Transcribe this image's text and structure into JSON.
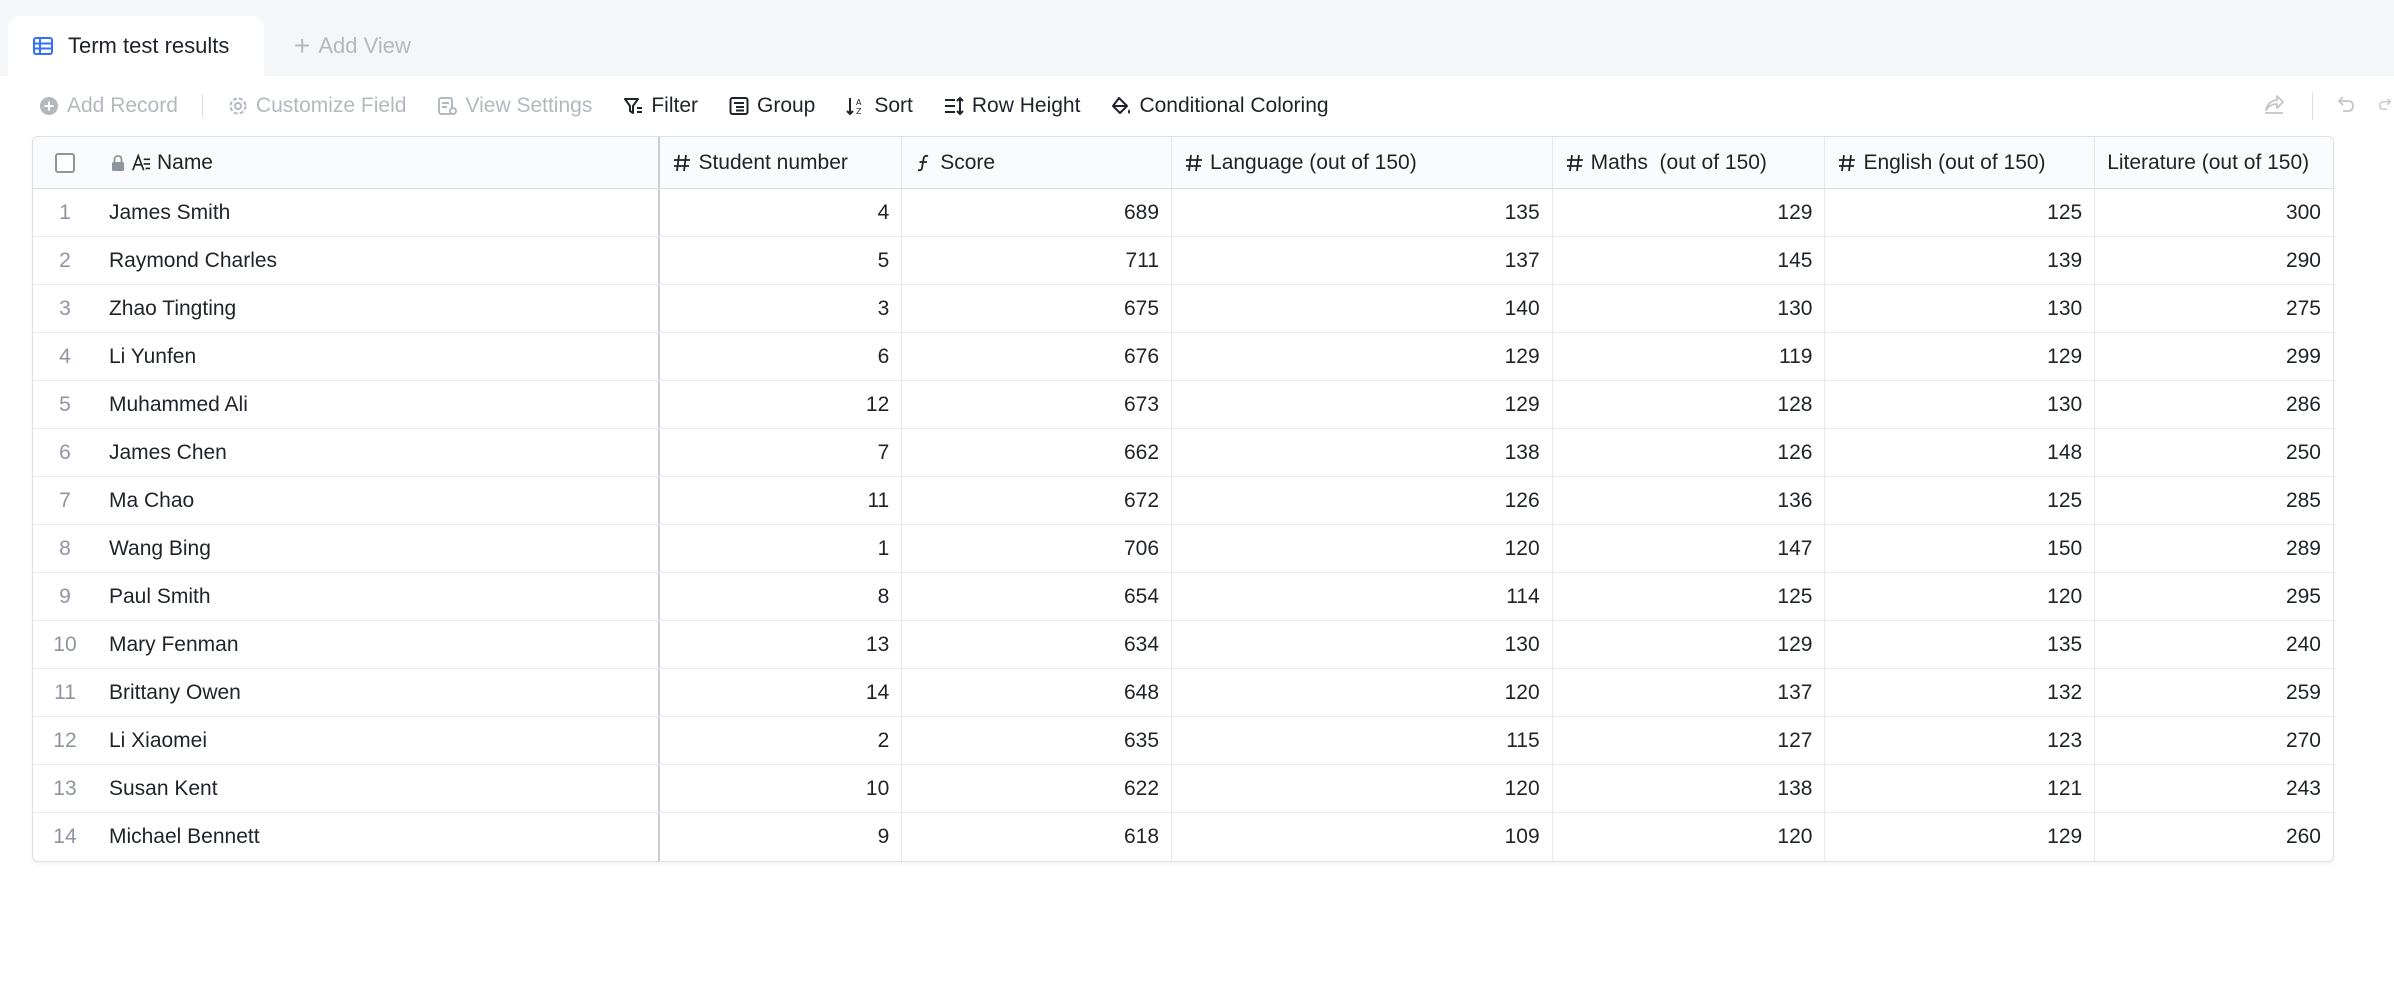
{
  "tabs": {
    "active_label": "Term test results",
    "add_view_label": "Add View"
  },
  "toolbar": {
    "add_record": "Add Record",
    "customize_field": "Customize Field",
    "view_settings": "View Settings",
    "filter": "Filter",
    "group": "Group",
    "sort": "Sort",
    "row_height": "Row Height",
    "conditional_coloring": "Conditional Coloring"
  },
  "columns": {
    "name": "Name",
    "student_number": "Student number",
    "score": "Score",
    "language": "Language (out of 150)",
    "maths": "Maths  (out of 150)",
    "english": "English (out of 150)",
    "literature": "Literature (out of 150)"
  },
  "rows": [
    {
      "num": "1",
      "name": "James Smith",
      "sn": "4",
      "score": "689",
      "lang": "135",
      "math": "129",
      "eng": "125",
      "lit": "300"
    },
    {
      "num": "2",
      "name": "Raymond Charles",
      "sn": "5",
      "score": "711",
      "lang": "137",
      "math": "145",
      "eng": "139",
      "lit": "290"
    },
    {
      "num": "3",
      "name": "Zhao Tingting",
      "sn": "3",
      "score": "675",
      "lang": "140",
      "math": "130",
      "eng": "130",
      "lit": "275"
    },
    {
      "num": "4",
      "name": "Li Yunfen",
      "sn": "6",
      "score": "676",
      "lang": "129",
      "math": "119",
      "eng": "129",
      "lit": "299"
    },
    {
      "num": "5",
      "name": "Muhammed Ali",
      "sn": "12",
      "score": "673",
      "lang": "129",
      "math": "128",
      "eng": "130",
      "lit": "286"
    },
    {
      "num": "6",
      "name": "James Chen",
      "sn": "7",
      "score": "662",
      "lang": "138",
      "math": "126",
      "eng": "148",
      "lit": "250"
    },
    {
      "num": "7",
      "name": "Ma Chao",
      "sn": "11",
      "score": "672",
      "lang": "126",
      "math": "136",
      "eng": "125",
      "lit": "285"
    },
    {
      "num": "8",
      "name": "Wang Bing",
      "sn": "1",
      "score": "706",
      "lang": "120",
      "math": "147",
      "eng": "150",
      "lit": "289"
    },
    {
      "num": "9",
      "name": "Paul Smith",
      "sn": "8",
      "score": "654",
      "lang": "114",
      "math": "125",
      "eng": "120",
      "lit": "295"
    },
    {
      "num": "10",
      "name": "Mary Fenman",
      "sn": "13",
      "score": "634",
      "lang": "130",
      "math": "129",
      "eng": "135",
      "lit": "240"
    },
    {
      "num": "11",
      "name": "Brittany Owen",
      "sn": "14",
      "score": "648",
      "lang": "120",
      "math": "137",
      "eng": "132",
      "lit": "259"
    },
    {
      "num": "12",
      "name": "Li Xiaomei",
      "sn": "2",
      "score": "635",
      "lang": "115",
      "math": "127",
      "eng": "123",
      "lit": "270"
    },
    {
      "num": "13",
      "name": "Susan Kent",
      "sn": "10",
      "score": "622",
      "lang": "120",
      "math": "138",
      "eng": "121",
      "lit": "243"
    },
    {
      "num": "14",
      "name": "Michael Bennett",
      "sn": "9",
      "score": "618",
      "lang": "109",
      "math": "120",
      "eng": "129",
      "lit": "260"
    }
  ],
  "colors": {
    "accent": "#3370ff",
    "disabled_text": "#b4b8bf",
    "border": "#dee0e3"
  }
}
